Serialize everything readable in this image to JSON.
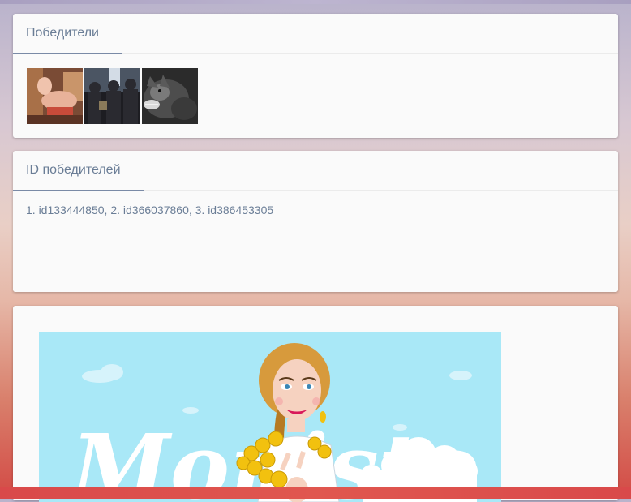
{
  "winners_card": {
    "title": "Победители",
    "photos": [
      {
        "icon": "winner-photo-1"
      },
      {
        "icon": "winner-photo-2"
      },
      {
        "icon": "winner-photo-3"
      }
    ]
  },
  "ids_card": {
    "title": "ID победителей",
    "text": "1. id133444850, 2. id366037860, 3. id386453305"
  },
  "banner_card": {
    "logo_text": "Monisto",
    "colors": {
      "sky": "#a9e8f7",
      "cloud": "#d6f3fb",
      "gold": "#f2c10f"
    }
  }
}
